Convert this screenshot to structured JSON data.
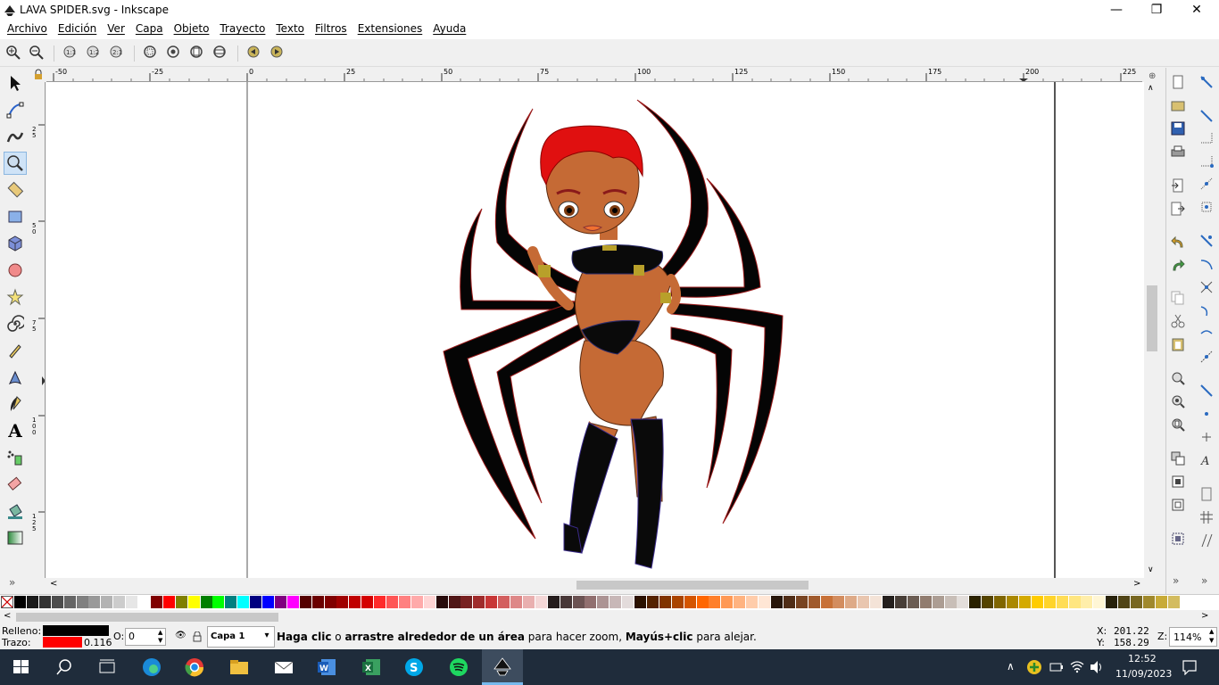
{
  "window": {
    "title": "LAVA SPIDER.svg - Inkscape",
    "minimize": "—",
    "maximize": "❐",
    "close": "✕"
  },
  "menu": [
    "Archivo",
    "Edición",
    "Ver",
    "Capa",
    "Objeto",
    "Trayecto",
    "Texto",
    "Filtros",
    "Extensiones",
    "Ayuda"
  ],
  "ruler": {
    "h_ticks": [
      "-50",
      "-25",
      "0",
      "25",
      "50",
      "75",
      "100",
      "125",
      "150",
      "175",
      "200",
      "225"
    ],
    "v_ticks": [
      "25",
      "50",
      "75",
      "100",
      "125"
    ]
  },
  "tools": [
    "selector-tool-icon",
    "node-tool-icon",
    "tweak-tool-icon",
    "zoom-tool-icon",
    "measure-tool-icon",
    "rect-tool-icon",
    "3dbox-tool-icon",
    "circle-tool-icon",
    "star-tool-icon",
    "spiral-tool-icon",
    "pencil-tool-icon",
    "pen-tool-icon",
    "calligraphy-tool-icon",
    "text-tool-icon",
    "spray-tool-icon",
    "eraser-tool-icon",
    "bucket-tool-icon",
    "gradient-tool-icon"
  ],
  "palette": [
    "#000000",
    "#1a1a1a",
    "#333333",
    "#4d4d4d",
    "#666666",
    "#808080",
    "#999999",
    "#b3b3b3",
    "#cccccc",
    "#e6e6e6",
    "#ffffff",
    "#800000",
    "#ff0000",
    "#808000",
    "#ffff00",
    "#008000",
    "#00ff00",
    "#008080",
    "#00ffff",
    "#000080",
    "#0000ff",
    "#800080",
    "#ff00ff",
    "#550000",
    "#6b0000",
    "#800000",
    "#a00000",
    "#c00000",
    "#d40000",
    "#ff2a2a",
    "#ff5555",
    "#ff8080",
    "#ffaaaa",
    "#ffd5d5",
    "#280b0b",
    "#501616",
    "#782121",
    "#a02c2c",
    "#c83737",
    "#d35f5f",
    "#de8787",
    "#e9afaf",
    "#f4d7d7",
    "#241c1c",
    "#483737",
    "#6c5353",
    "#916f6f",
    "#ac9393",
    "#c8b7b7",
    "#e3dbdb",
    "#2b1100",
    "#552200",
    "#803300",
    "#aa4400",
    "#d45500",
    "#ff6600",
    "#ff7f2a",
    "#ff9955",
    "#ffb380",
    "#ffccaa",
    "#ffe6d5",
    "#28170b",
    "#502d16",
    "#784421",
    "#a05a2c",
    "#c87137",
    "#d38d5f",
    "#deaa87",
    "#e9c6af",
    "#f4e3d7",
    "#241f1c",
    "#483e37",
    "#6c5d53",
    "#917c6f",
    "#ac9d93",
    "#c8beb7",
    "#e3dedb",
    "#2b2200",
    "#554400",
    "#806600",
    "#aa8800",
    "#d4aa00",
    "#ffcc00",
    "#ffd42a",
    "#ffdd55",
    "#ffe680",
    "#ffeeaa",
    "#fff6d5",
    "#28220b",
    "#504416",
    "#786721",
    "#a0892c",
    "#c8ab37",
    "#d3bc5f"
  ],
  "status": {
    "fill_label": "Relleno:",
    "stroke_label": "Trazo:",
    "fill_color": "#000000",
    "stroke_color": "#ff0000",
    "stroke_width": "0.116",
    "opacity_label": "O:",
    "opacity_value": "0",
    "layer": "Capa 1",
    "message_b1": "Haga clic",
    "message_t1": " o ",
    "message_b2": "arrastre alrededor de un área",
    "message_t2": " para hacer zoom, ",
    "message_b3": "Mayús+clic",
    "message_t3": " para alejar.",
    "x_label": "X:",
    "x_value": "201.22",
    "y_label": "Y:",
    "y_value": "158.29",
    "zoom_label": "Z:",
    "zoom_value": "114%"
  },
  "taskbar": {
    "time": "12:52",
    "date": "11/09/2023"
  }
}
